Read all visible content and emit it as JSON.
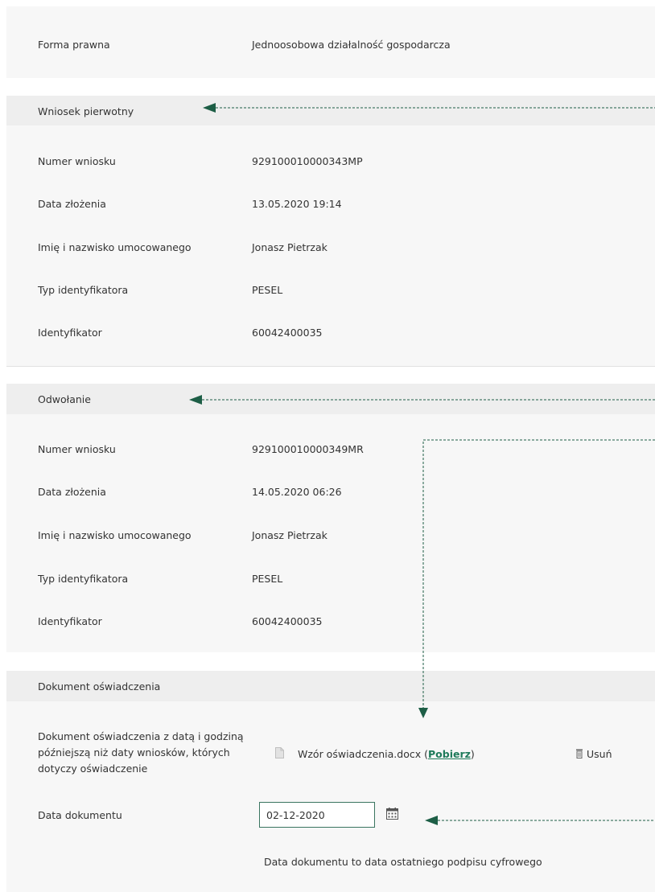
{
  "top_panel": {
    "label": "Forma prawna",
    "value": "Jednoosobowa działalność gospodarcza"
  },
  "wniosek": {
    "header": "Wniosek pierwotny",
    "rows": [
      {
        "label": "Numer wniosku",
        "value": "929100010000343MP"
      },
      {
        "label": "Data złożenia",
        "value": "13.05.2020 19:14"
      },
      {
        "label": "Imię i nazwisko umocowanego",
        "value": "Jonasz Pietrzak"
      },
      {
        "label": "Typ identyfikatora",
        "value": "PESEL"
      },
      {
        "label": "Identyfikator",
        "value": "60042400035"
      }
    ]
  },
  "odwolanie": {
    "header": "Odwołanie",
    "rows": [
      {
        "label": "Numer wniosku",
        "value": "929100010000349MR"
      },
      {
        "label": "Data złożenia",
        "value": "14.05.2020 06:26"
      },
      {
        "label": "Imię i nazwisko umocowanego",
        "value": "Jonasz Pietrzak"
      },
      {
        "label": "Typ identyfikatora",
        "value": "PESEL"
      },
      {
        "label": "Identyfikator",
        "value": "60042400035"
      }
    ]
  },
  "dokument": {
    "header": "Dokument oświadczenia",
    "doc_label": "Dokument oświadczenia z datą i godziną późniejszą niż daty wniosków, których dotyczy oświadczenie",
    "file_name": "Wzór oświadczenia.docx (",
    "download_label": "Pobierz",
    "file_suffix": ")",
    "delete_label": "Usuń",
    "date_label": "Data dokumentu",
    "date_value": "02-12-2020",
    "hint": "Data dokumentu to data ostatniego podpisu cyfrowego"
  },
  "colors": {
    "accent": "#1e7a5a",
    "arrow": "#1d5e46",
    "panel": "#f7f7f7",
    "header": "#eeeeee"
  }
}
